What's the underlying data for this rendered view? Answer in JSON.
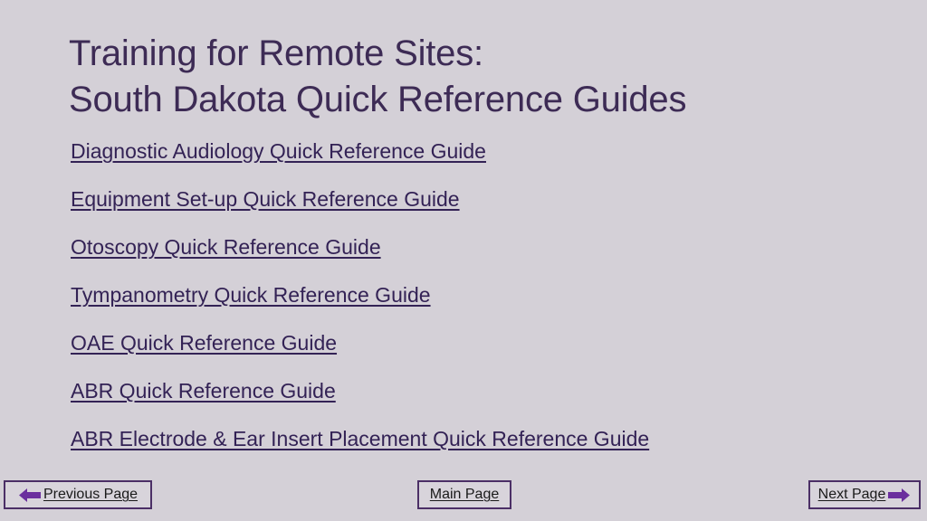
{
  "slide": {
    "background_color": "#d4d0d7",
    "title": {
      "color": "#3d2b55",
      "line1": "Training for Remote Sites:",
      "line2": "South Dakota Quick Reference Guides"
    },
    "links": {
      "color": "#332255",
      "items": [
        {
          "label": "Diagnostic Audiology Quick Reference Guide"
        },
        {
          "label": "Equipment Set-up Quick Reference Guide"
        },
        {
          "label": "Otoscopy Quick Reference Guide"
        },
        {
          "label": "Tympanometry Quick Reference Guide"
        },
        {
          "label": "OAE Quick Reference Guide"
        },
        {
          "label": "ABR Quick Reference Guide"
        },
        {
          "label": "ABR Electrode & Ear Insert Placement Quick Reference Guide"
        }
      ]
    }
  },
  "navigation": {
    "border_color": "#4b2f66",
    "arrow_color": "#6b2f9e",
    "previous": {
      "label": "Previous Page",
      "icon": "arrow-left-icon"
    },
    "main": {
      "label": "Main Page"
    },
    "next": {
      "label": "Next Page",
      "icon": "arrow-right-icon"
    }
  }
}
